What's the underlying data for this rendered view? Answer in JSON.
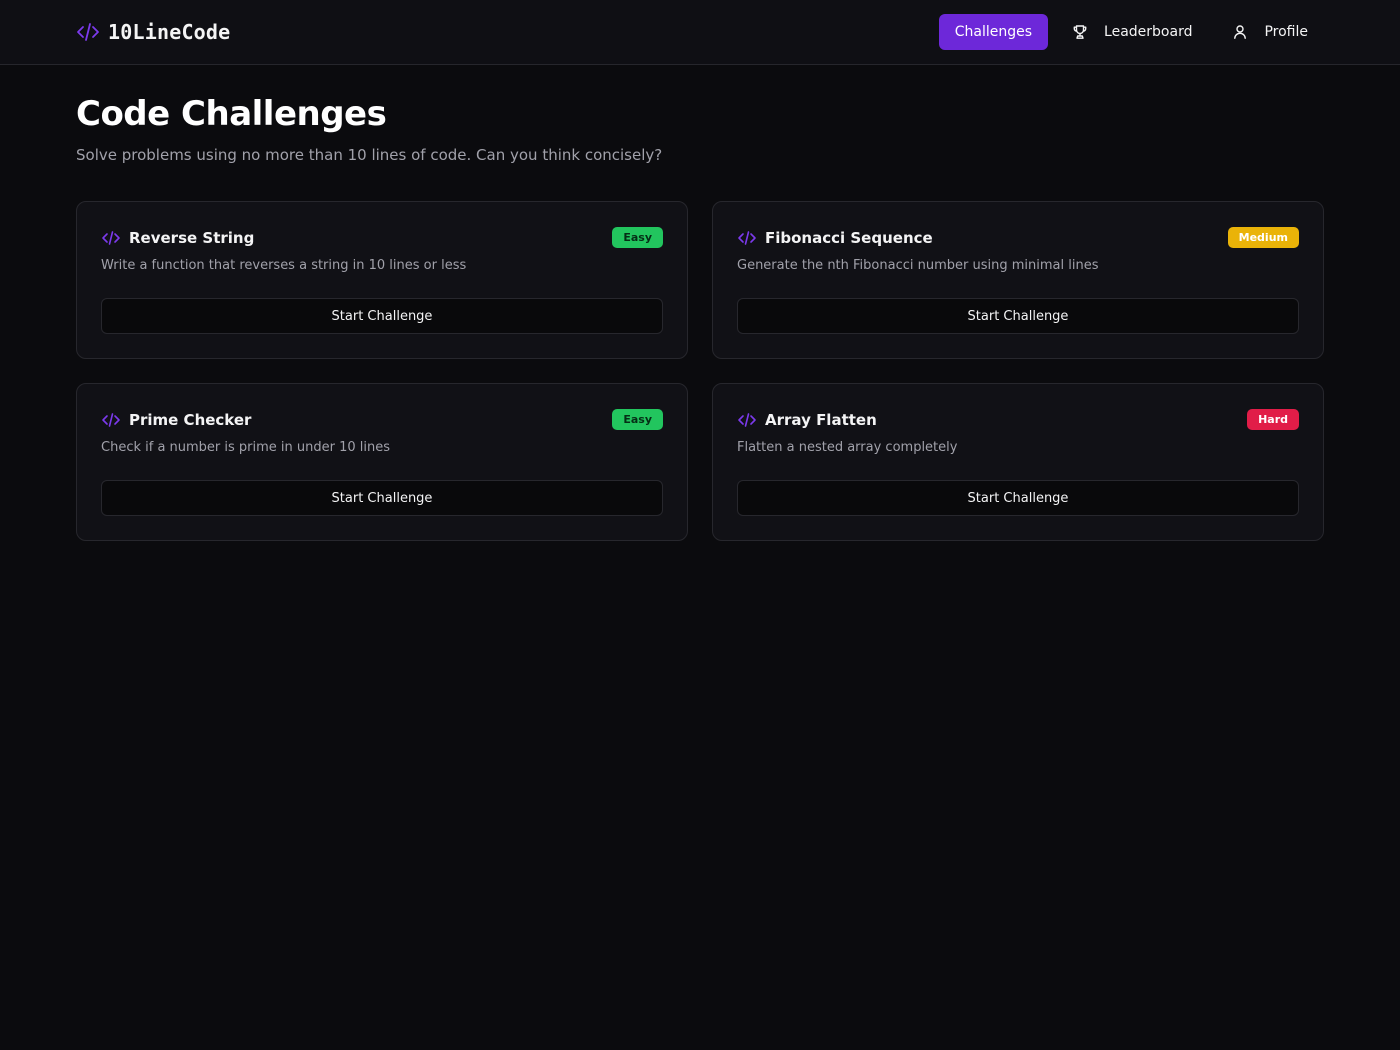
{
  "brand": {
    "name": "10LineCode",
    "icon": "code-icon",
    "accent_color": "#7c3aed"
  },
  "nav": {
    "items": [
      {
        "label": "Challenges",
        "icon": "",
        "active": true
      },
      {
        "label": "Leaderboard",
        "icon": "trophy-icon",
        "active": false
      },
      {
        "label": "Profile",
        "icon": "user-icon",
        "active": false
      }
    ],
    "active_color": "#6d28d9"
  },
  "page": {
    "title": "Code Challenges",
    "subtitle": "Solve problems using no more than 10 lines of code. Can you think concisely?"
  },
  "challenges": [
    {
      "title": "Reverse String",
      "description": "Write a function that reverses a string in 10 lines or less",
      "difficulty": "Easy",
      "badge_bg": "#22c55e",
      "badge_fg": "#052e16",
      "action_label": "Start Challenge"
    },
    {
      "title": "Fibonacci Sequence",
      "description": "Generate the nth Fibonacci number using minimal lines",
      "difficulty": "Medium",
      "badge_bg": "#eab308",
      "badge_fg": "#ffffff",
      "action_label": "Start Challenge"
    },
    {
      "title": "Prime Checker",
      "description": "Check if a number is prime in under 10 lines",
      "difficulty": "Easy",
      "badge_bg": "#22c55e",
      "badge_fg": "#052e16",
      "action_label": "Start Challenge"
    },
    {
      "title": "Array Flatten",
      "description": "Flatten a nested array completely",
      "difficulty": "Hard",
      "badge_bg": "#e11d48",
      "badge_fg": "#ffffff",
      "action_label": "Start Challenge"
    }
  ]
}
